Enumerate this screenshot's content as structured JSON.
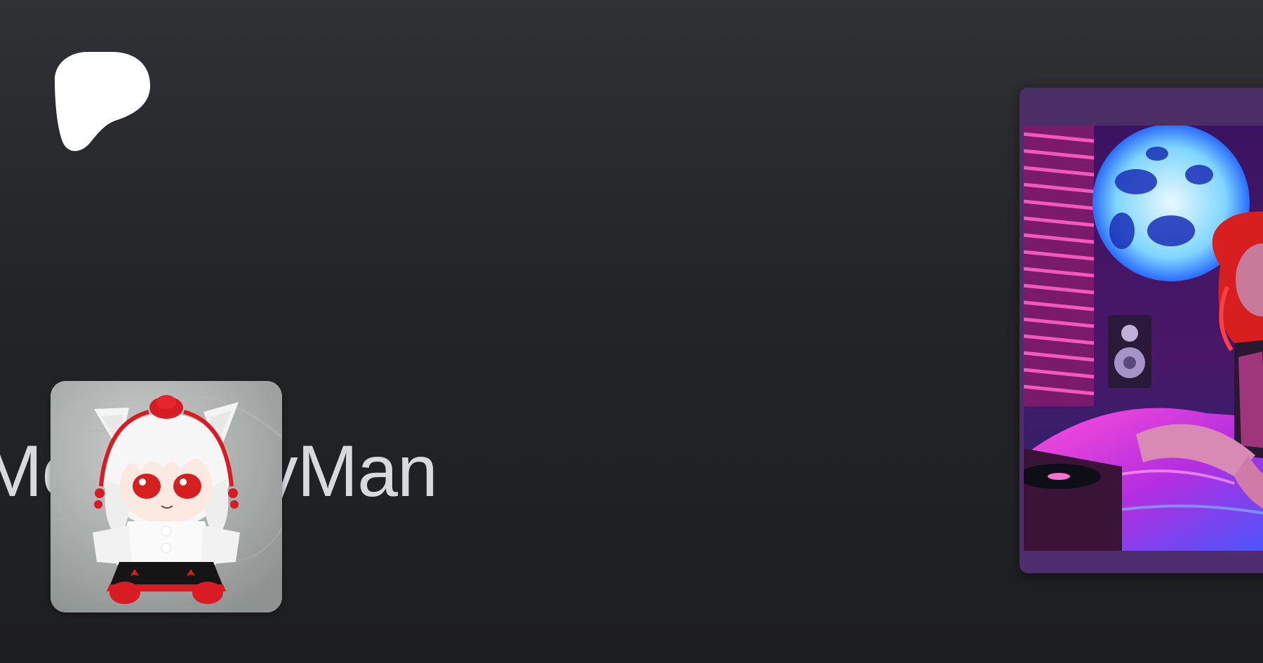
{
  "brand": {
    "logo_icon": "patreon-logo-icon"
  },
  "creator": {
    "name": "MoMoneyMan",
    "avatar_icon": "plush-doll-avatar-icon"
  },
  "preview": {
    "image_icon": "neon-bedroom-illustration-icon"
  },
  "colors": {
    "page_background_top": "#2f3134",
    "page_background_bottom": "#1d1e20",
    "card_frame": "#4e2d6e",
    "name_text": "#d8d9dc"
  }
}
